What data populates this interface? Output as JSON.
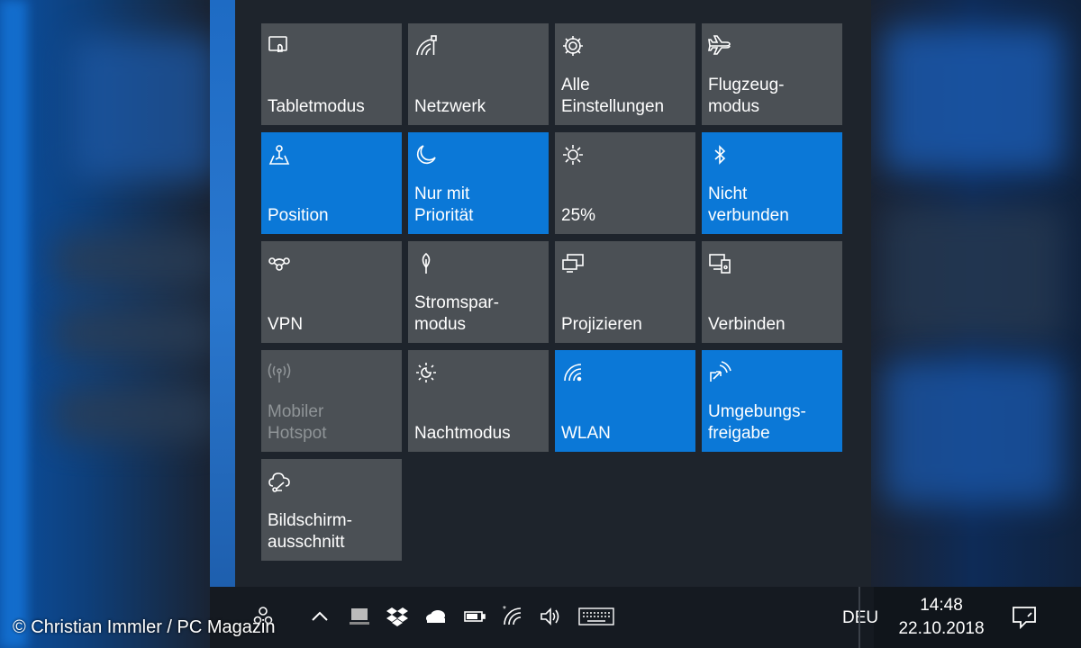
{
  "tiles": [
    {
      "label": "Tabletmodus",
      "icon": "tablet-mode-icon",
      "state": "off"
    },
    {
      "label": "Netzwerk",
      "icon": "network-icon",
      "state": "off"
    },
    {
      "label": "Alle\nEinstellungen",
      "icon": "gear-icon",
      "state": "off"
    },
    {
      "label": "Flugzeug-\nmodus",
      "icon": "airplane-icon",
      "state": "off"
    },
    {
      "label": "Position",
      "icon": "location-icon",
      "state": "on"
    },
    {
      "label": "Nur mit\nPriorität",
      "icon": "moon-icon",
      "state": "on"
    },
    {
      "label": "25%",
      "icon": "brightness-icon",
      "state": "off"
    },
    {
      "label": "Nicht\nverbunden",
      "icon": "bluetooth-icon",
      "state": "on"
    },
    {
      "label": "VPN",
      "icon": "vpn-icon",
      "state": "off"
    },
    {
      "label": "Stromspar-\nmodus",
      "icon": "battery-saver-icon",
      "state": "off"
    },
    {
      "label": "Projizieren",
      "icon": "project-icon",
      "state": "off"
    },
    {
      "label": "Verbinden",
      "icon": "connect-icon",
      "state": "off"
    },
    {
      "label": "Mobiler\nHotspot",
      "icon": "hotspot-icon",
      "state": "disabled"
    },
    {
      "label": "Nachtmodus",
      "icon": "night-light-icon",
      "state": "off"
    },
    {
      "label": "WLAN",
      "icon": "wifi-icon",
      "state": "on"
    },
    {
      "label": "Umgebungs-\nfreigabe",
      "icon": "nearby-sharing-icon",
      "state": "on"
    },
    {
      "label": "Bildschirm-\nausschnitt",
      "icon": "screen-snip-icon",
      "state": "off"
    }
  ],
  "taskbar": {
    "language": "DEU",
    "time": "14:48",
    "date": "22.10.2018"
  },
  "credit": "© Christian Immler / PC Magazin",
  "colors": {
    "tile_on": "#0b78d7",
    "tile_off": "#4b5055",
    "panel": "#1e242c",
    "taskbar": "#151a21"
  }
}
